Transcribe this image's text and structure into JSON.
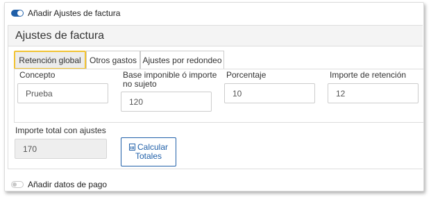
{
  "toggles": {
    "invoice_adjustments": {
      "label": "Añadir Ajustes de factura",
      "state": "on"
    },
    "payment_data": {
      "label": "Añadir datos de pago",
      "state": "off"
    }
  },
  "panel": {
    "title": "Ajustes de factura"
  },
  "tabs": [
    {
      "label": "Retención global",
      "active": true
    },
    {
      "label": "Otros gastos",
      "active": false
    },
    {
      "label": "Ajustes por redondeo",
      "active": false
    }
  ],
  "fields": {
    "concepto": {
      "label": "Concepto",
      "value": "Prueba"
    },
    "base": {
      "label_line1": "Base imponible ó importe",
      "label_line2": "no sujeto",
      "value": "120"
    },
    "porcentaje": {
      "label": "Porcentaje",
      "value": "10"
    },
    "importe_retencion": {
      "label": "Importe de retención",
      "value": "12"
    },
    "importe_total": {
      "label": "Importe total con ajustes",
      "value": "170"
    }
  },
  "buttons": {
    "calculate_line1": "Calcular",
    "calculate_line2": "Totales"
  },
  "colors": {
    "accent": "#1f5fa8",
    "active_tab_border": "#f2c230"
  },
  "icons": {
    "calculate": "calculator-icon"
  }
}
